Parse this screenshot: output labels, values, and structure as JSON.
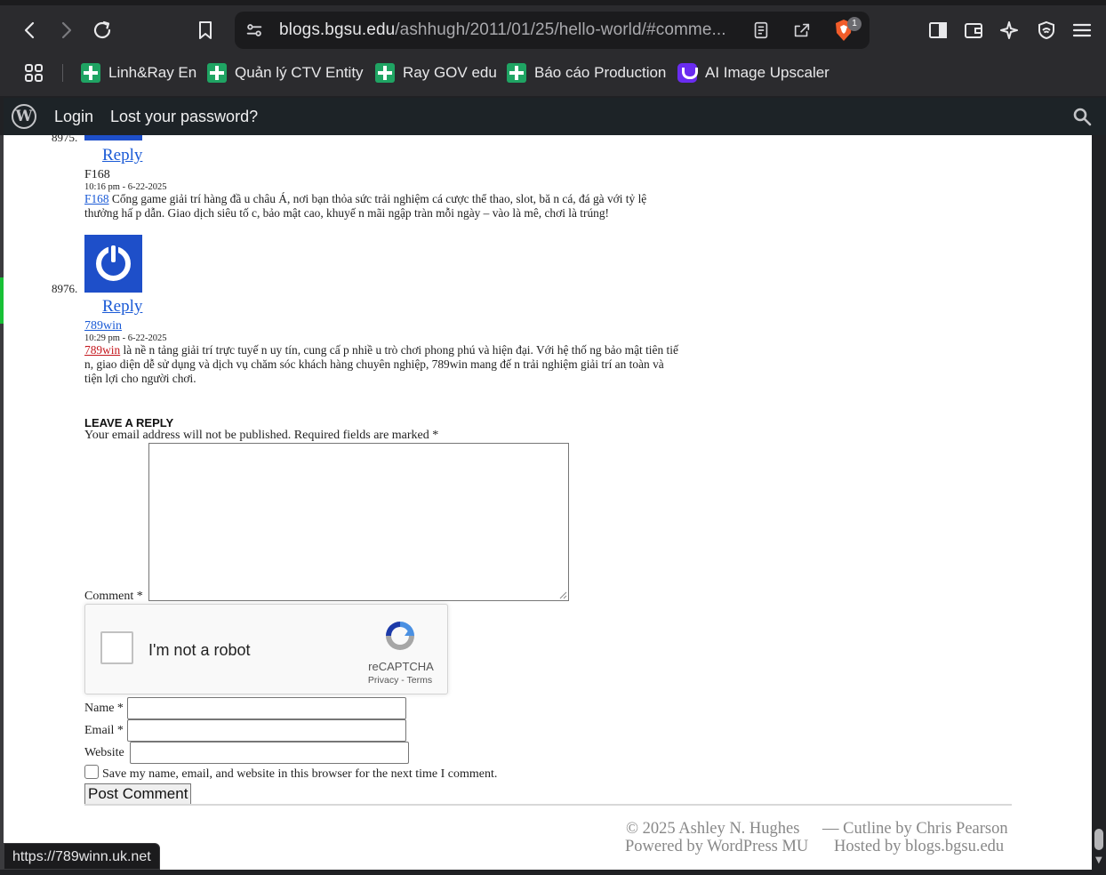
{
  "browser": {
    "url_host": "blogs.bgsu.edu",
    "url_path": "/ashhugh/2011/01/25/hello-world/#comme...",
    "shields_count": "1",
    "bookmarks": [
      {
        "label": "Linh&Ray En",
        "icon": "sheet-icon"
      },
      {
        "label": "Quản lý CTV Entity",
        "icon": "sheet-icon"
      },
      {
        "label": "Ray GOV edu",
        "icon": "sheet-icon"
      },
      {
        "label": "Báo cáo Production",
        "icon": "sheet-icon"
      },
      {
        "label": "AI Image Upscaler",
        "icon": "ai-icon"
      }
    ]
  },
  "adminbar": {
    "login": "Login",
    "lost_password": "Lost your password?"
  },
  "comments": [
    {
      "number": "8975.",
      "reply": "Reply",
      "author": "F168",
      "date": "10:16 pm - 6-22-2025",
      "link_text": "F168",
      "body": " Cổng game giải trí hàng đầ u châu Á, nơi bạn thỏa sức trải nghiệm cá cược thể thao, slot, bă n cá, đá gà với tỷ lệ thưởng hấ p dẫn. Giao dịch siêu tố c, bảo mật cao, khuyế n mãi ngập tràn mỗi ngày – vào là mê, chơi là trúng!"
    },
    {
      "number": "8976.",
      "reply": "Reply",
      "author": "789win",
      "date": "10:29 pm - 6-22-2025",
      "link_text": "789win",
      "body": " là nề n tảng giải trí trực tuyế n uy tín, cung cấ p nhiề u trò chơi phong phú và hiện đại. Với hệ thố ng bảo mật tiên tiế n, giao diện dễ sử dụng và dịch vụ chăm sóc khách hàng chuyên nghiệp, 789win mang đế n trải nghiệm giải trí an toàn và tiện lợi cho người chơi."
    }
  ],
  "reply_form": {
    "heading": "LEAVE A REPLY",
    "notes": "Your email address will not be published. Required fields are marked *",
    "comment_label": "Comment *",
    "captcha_label": "I'm not a robot",
    "captcha_brand": "reCAPTCHA",
    "captcha_links": "Privacy - Terms",
    "name_label": "Name *",
    "email_label": "Email *",
    "website_label": "Website",
    "save_label": "Save my name, email, and website in this browser for the next time I comment.",
    "submit": "Post Comment"
  },
  "footer": {
    "copyright": "© 2025 Ashley N. Hughes",
    "theme": "— Cutline by Chris Pearson",
    "powered": "Powered by WordPress MU",
    "hosted": "Hosted by blogs.bgsu.edu"
  },
  "status_bar": {
    "hover_url": "https://789winn.uk.net"
  }
}
